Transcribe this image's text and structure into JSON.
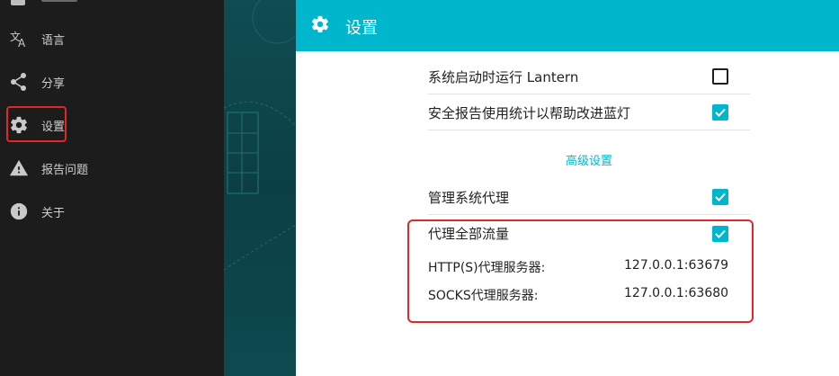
{
  "sidebar": {
    "items": [
      {
        "label": "语言",
        "icon": "translate-icon"
      },
      {
        "label": "分享",
        "icon": "share-icon"
      },
      {
        "label": "设置",
        "icon": "gear-icon"
      },
      {
        "label": "报告问题",
        "icon": "warning-icon"
      },
      {
        "label": "关于",
        "icon": "info-icon"
      }
    ]
  },
  "header": {
    "title": "设置",
    "icon": "gear-icon"
  },
  "settings": {
    "launch_on_startup": {
      "label": "系统启动时运行 Lantern",
      "checked": false
    },
    "report_stats": {
      "label": "安全报告使用统计以帮助改进蓝灯",
      "checked": true
    },
    "advanced_title": "高级设置",
    "manage_proxy": {
      "label": "管理系统代理",
      "checked": true
    },
    "proxy_all": {
      "label": "代理全部流量",
      "checked": true
    },
    "http_proxy": {
      "label": "HTTP(S)代理服务器:",
      "value": "127.0.0.1:63679"
    },
    "socks_proxy": {
      "label": "SOCKS代理服务器:",
      "value": "127.0.0.1:63680"
    }
  },
  "colors": {
    "accent": "#00b6cc",
    "highlight": "#e3262a",
    "sidebar_bg": "#1c1c1c"
  }
}
